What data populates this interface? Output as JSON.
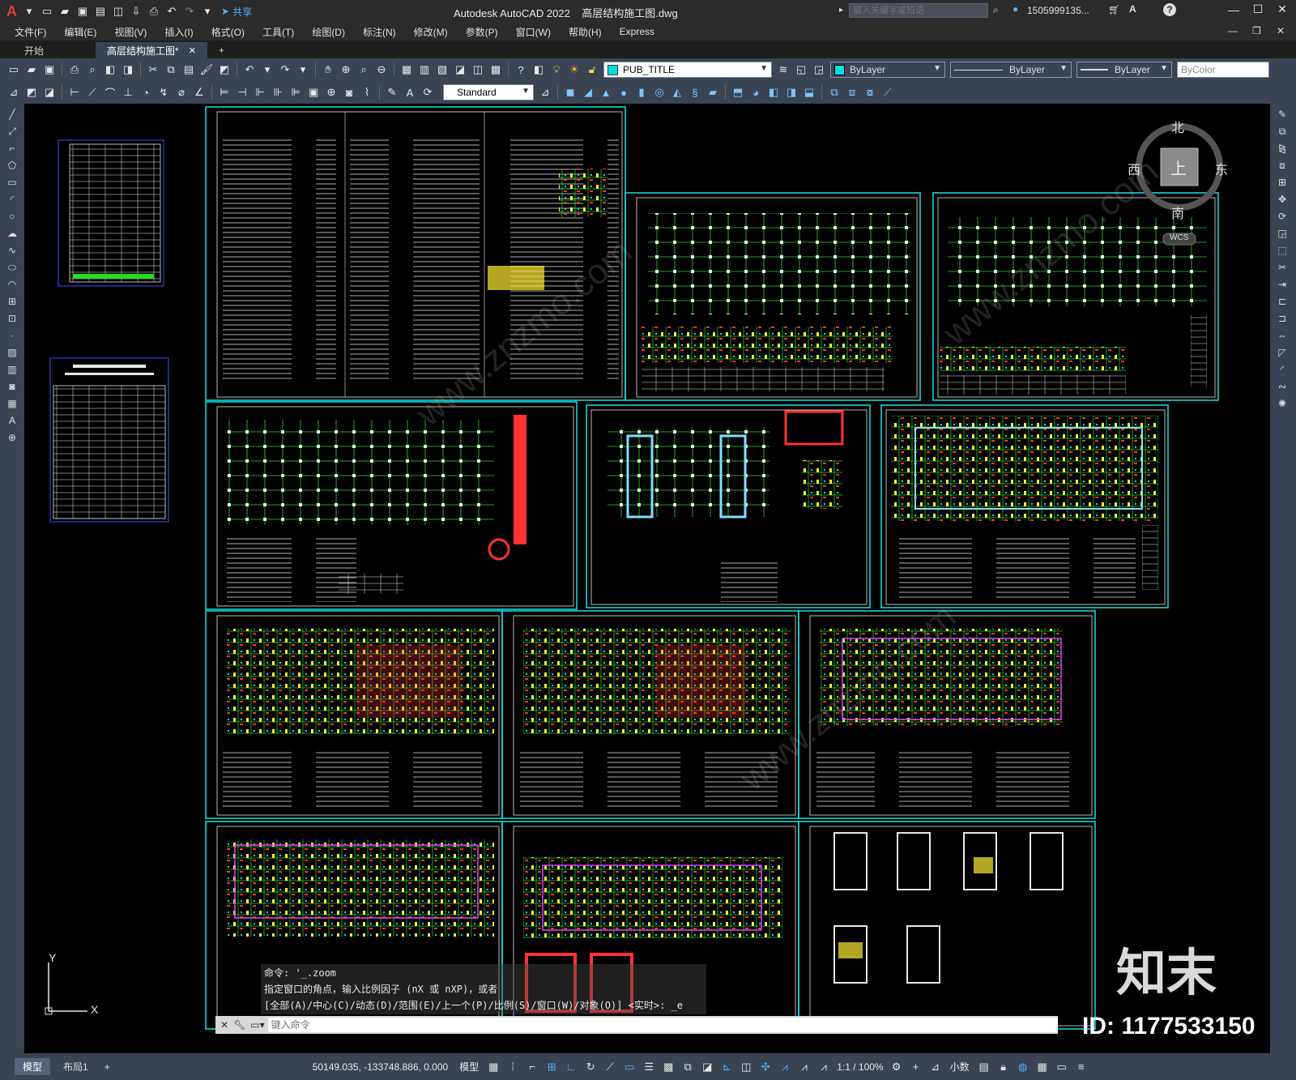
{
  "app": {
    "title": "Autodesk AutoCAD 2022",
    "filename": "高层结构施工图.dwg",
    "search_placeholder": "键入关键字或短语",
    "user": "1505999135...",
    "share_label": "共享"
  },
  "menu": [
    "文件(F)",
    "编辑(E)",
    "视图(V)",
    "插入(I)",
    "格式(O)",
    "工具(T)",
    "绘图(D)",
    "标注(N)",
    "修改(M)",
    "参数(P)",
    "窗口(W)",
    "帮助(H)",
    "Express"
  ],
  "tabs": {
    "start": "开始",
    "drawing": "高层结构施工图*",
    "close": "✕",
    "add": "+"
  },
  "toolbar": {
    "layer": "PUB_TITLE",
    "color": "ByLayer",
    "linetype": "ByLayer",
    "lineweight": "ByLayer",
    "plotstyle": "ByColor",
    "textstyle": "Standard"
  },
  "viewcube": {
    "north": "北",
    "south": "南",
    "east": "东",
    "west": "西",
    "top": "上",
    "wcs": "WCS"
  },
  "ucs": {
    "x": "X",
    "y": "Y"
  },
  "command": {
    "line1": "命令: '_.zoom",
    "line2": "指定窗口的角点，输入比例因子 (nX 或 nXP)，或者",
    "line3": "[全部(A)/中心(C)/动态(D)/范围(E)/上一个(P)/比例(S)/窗口(W)/对象(O)] <实时>:  _e",
    "input_placeholder": "键入命令"
  },
  "status": {
    "tabs": [
      "模型",
      "布局1"
    ],
    "add": "+",
    "coords": "50149.035, -133748.886, 0.000",
    "mode": "模型",
    "scale": "1:1 / 100%",
    "units": "小数"
  },
  "watermark": {
    "brand": "知末",
    "id": "ID: 1177533150",
    "url": "www.znzmo.com"
  }
}
